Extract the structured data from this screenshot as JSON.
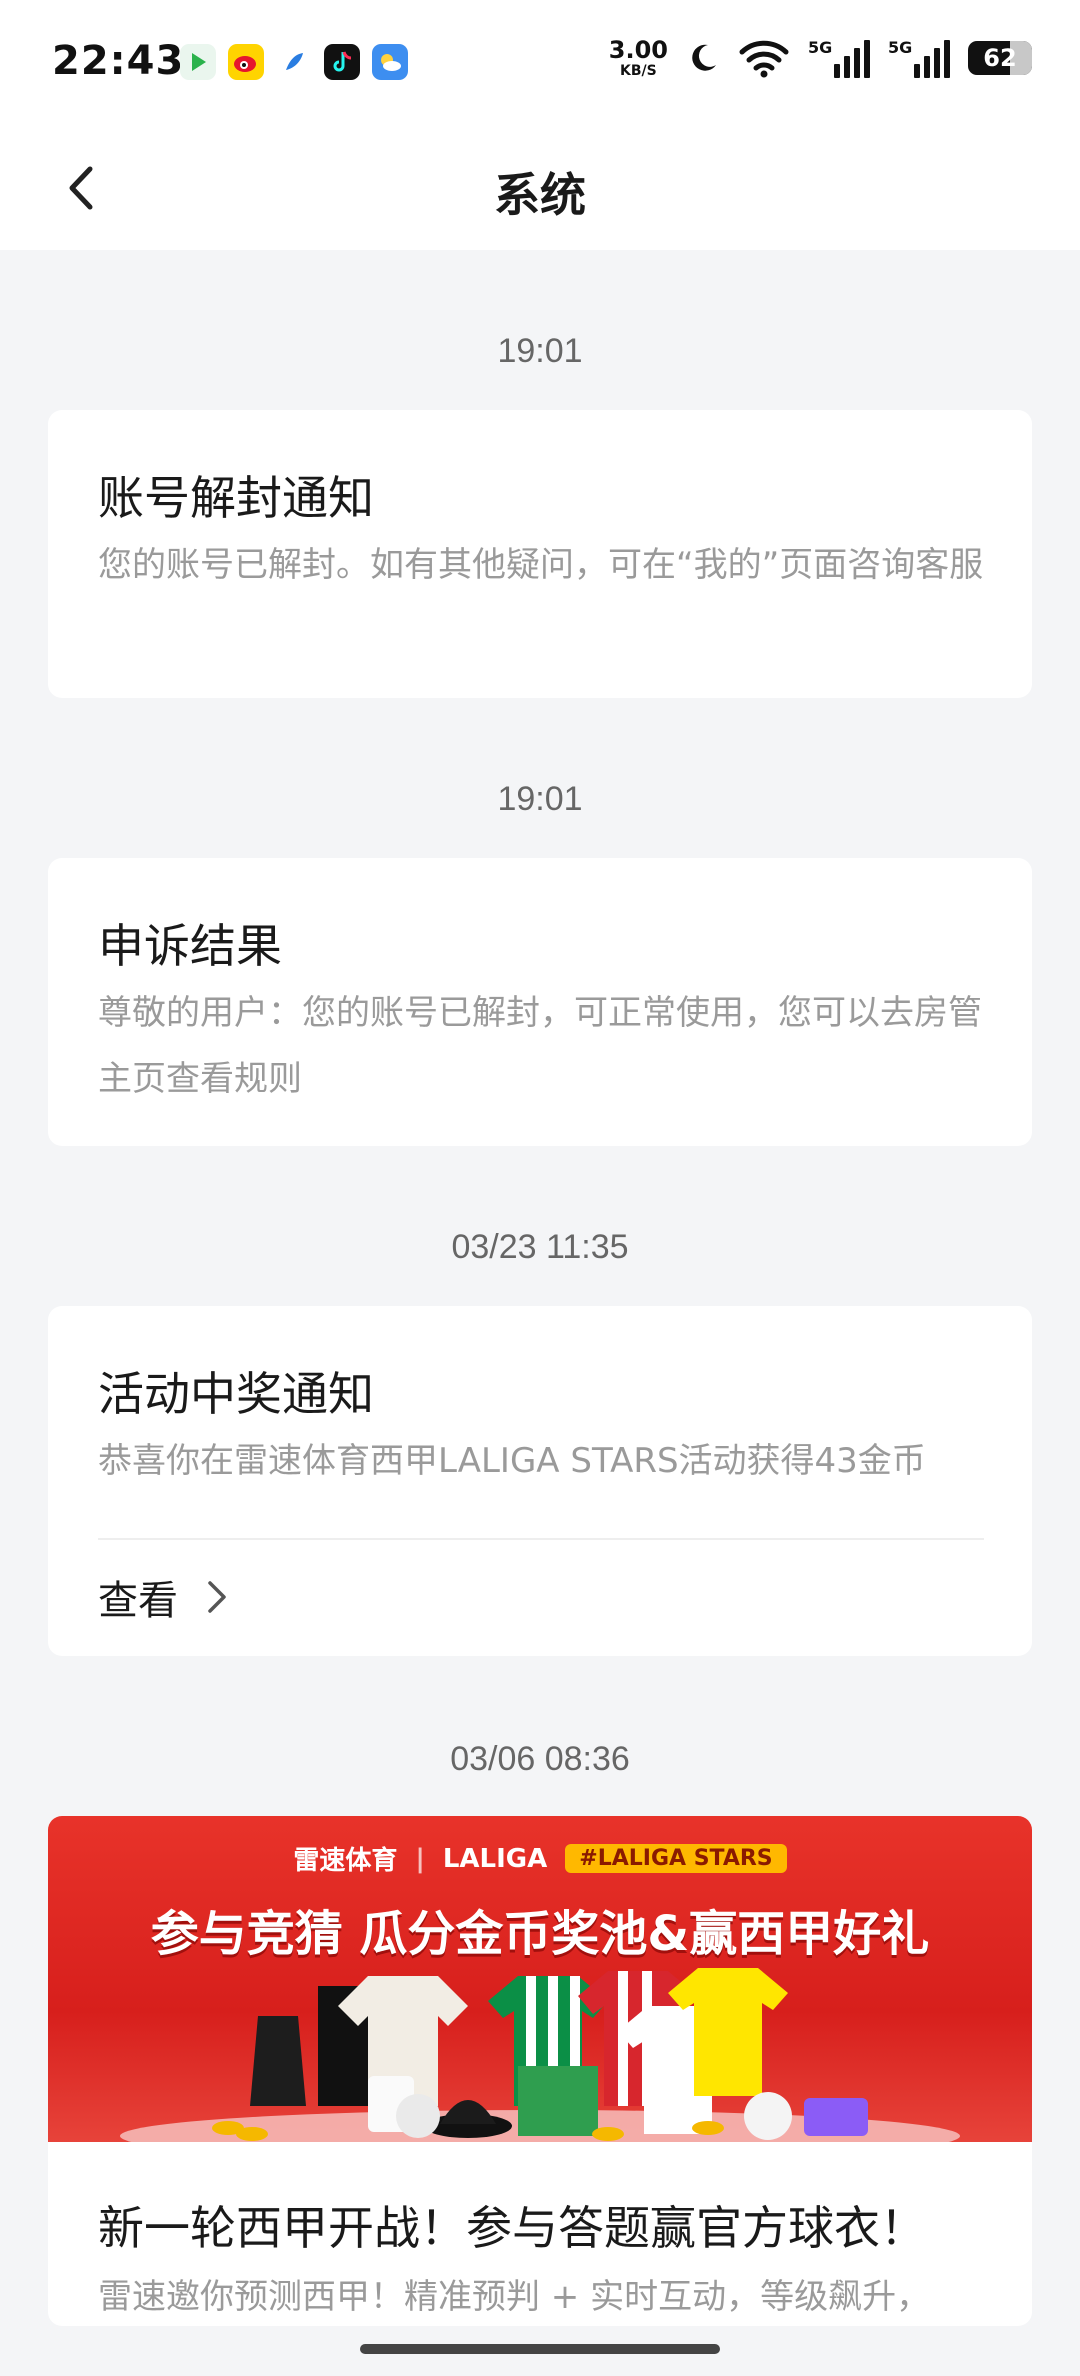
{
  "status_bar": {
    "time": "22:43",
    "net_speed_value": "3.00",
    "net_speed_unit": "KB/S",
    "signal1_label": "5G",
    "signal2_label": "5G",
    "battery": "62",
    "app_icons": [
      "video-app-icon",
      "weibo-icon",
      "feather-app-icon",
      "tiktok-icon",
      "weather-icon"
    ]
  },
  "header": {
    "title": "系统"
  },
  "messages": [
    {
      "time": "19:01",
      "title": "账号解封通知",
      "body": "您的账号已解封。如有其他疑问，可在“我的”页面咨询客服"
    },
    {
      "time": "19:01",
      "title": "申诉结果",
      "body": "尊敬的用户：您的账号已解封，可正常使用，您可以去房管主页查看规则"
    },
    {
      "time": "03/23 11:35",
      "title": "活动中奖通知",
      "body": "恭喜你在雷速体育西甲LALIGA STARS活动获得43金币",
      "action": "查看"
    },
    {
      "time": "03/06 08:36",
      "title": "新一轮西甲开战！参与答题赢官方球衣！",
      "body": "雷速邀你预测西甲！精准预判 + 实时互动，等级飙升，",
      "banner": {
        "brand": "雷速体育",
        "league": "LALIGA",
        "hashtag": "#LALIGA STARS",
        "headline": "参与竞猜 瓜分金币奖池&赢西甲好礼"
      }
    }
  ]
}
